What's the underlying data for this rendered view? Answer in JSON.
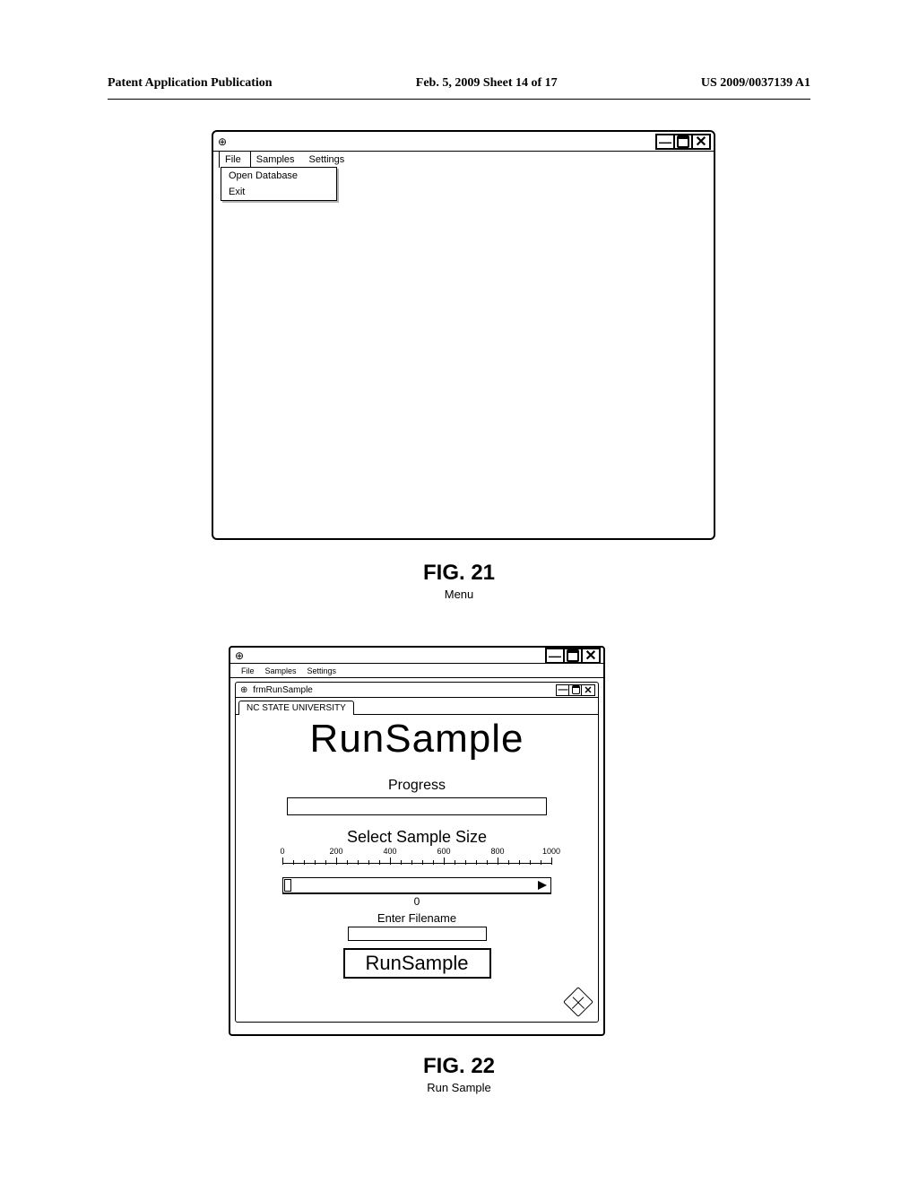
{
  "header": {
    "left": "Patent Application Publication",
    "center": "Feb. 5, 2009  Sheet 14 of 17",
    "right": "US 2009/0037139 A1"
  },
  "fig21": {
    "menus": {
      "file": "File",
      "samples": "Samples",
      "settings": "Settings"
    },
    "dropdown": {
      "open_db": "Open  Database",
      "exit": "Exit"
    },
    "caption_num": "FIG. 21",
    "caption_sub": "Menu"
  },
  "fig22": {
    "menus": {
      "file": "File",
      "samples": "Samples",
      "settings": "Settings"
    },
    "inner_title": "frmRunSample",
    "tab": "NC STATE UNIVERSITY",
    "heading": "RunSample",
    "progress_label": "Progress",
    "select_label": "Select Sample Size",
    "ruler": {
      "ticks": [
        0,
        200,
        400,
        600,
        800,
        1000
      ],
      "value": "0"
    },
    "enter_fn": "Enter Filename",
    "button": "RunSample",
    "caption_num": "FIG. 22",
    "caption_sub": "Run Sample"
  }
}
